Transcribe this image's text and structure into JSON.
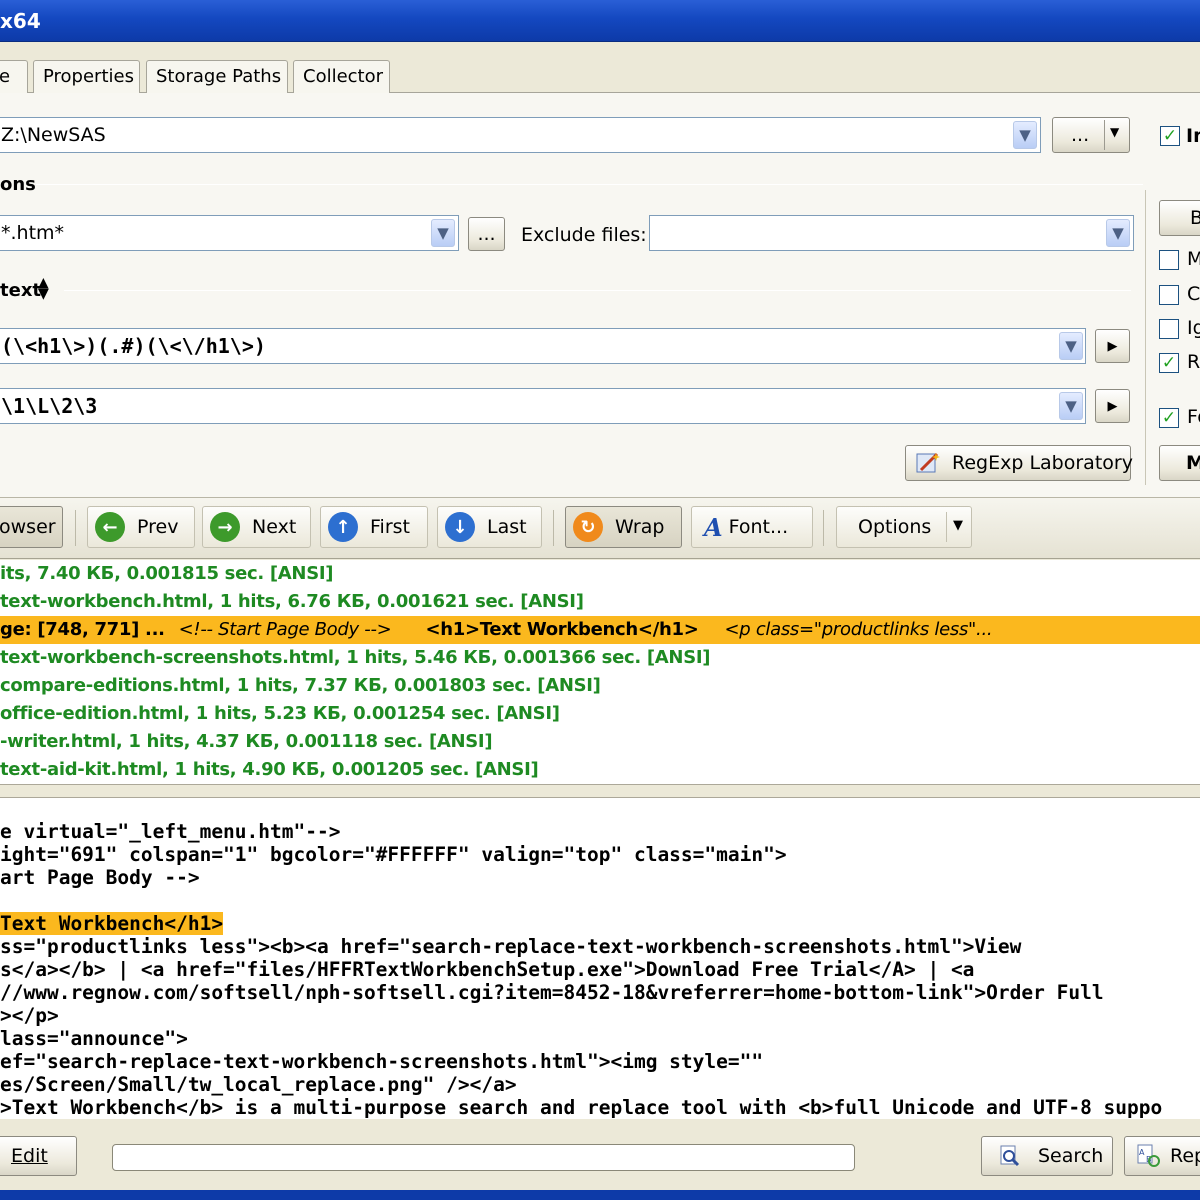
{
  "window": {
    "title": "x64"
  },
  "tabs": [
    {
      "label": "e"
    },
    {
      "label": "Properties"
    },
    {
      "label": "Storage Paths"
    },
    {
      "label": "Collector"
    }
  ],
  "folder": {
    "value": "Z:\\NewSAS",
    "browse_label": "...",
    "include_label": "In"
  },
  "options_section": {
    "label": "ons"
  },
  "file_mask": {
    "value": "*.htm*",
    "browse_label": "...",
    "exclude_label": "Exclude files:",
    "exclude_value": ""
  },
  "text_section": {
    "label": "text"
  },
  "find_pattern": {
    "value": "(\\<h1\\>)(.#)(\\<\\/h1\\>)"
  },
  "replace_pattern": {
    "value": "\\1\\L\\2\\3"
  },
  "regexp_lab": {
    "label": "RegExp Laboratory"
  },
  "right_panel": {
    "button_top": "B",
    "checks": [
      {
        "label": "M",
        "checked": false
      },
      {
        "label": "C",
        "checked": false
      },
      {
        "label": "Ig",
        "checked": false
      },
      {
        "label": "R",
        "checked": true
      },
      {
        "label": "Fo",
        "checked": true
      }
    ],
    "button_bottom": "M"
  },
  "toolbar": {
    "browser": "owser",
    "prev": "Prev",
    "next": "Next",
    "first": "First",
    "last": "Last",
    "wrap": "Wrap",
    "font": "Font...",
    "options": "Options"
  },
  "results": [
    {
      "text": "its, 7.40 КБ, 0.001815 sec. [ANSI]"
    },
    {
      "text": "text-workbench.html, 1 hits, 6.76 КБ, 0.001621 sec. [ANSI]"
    },
    {
      "text_a": "ge: [748, 771] ...",
      "text_b": "<!-- Start Page Body -->",
      "text_c": "<h1>Text Workbench</h1>",
      "text_d": "<p class=\"productlinks less\"..."
    },
    {
      "text": "text-workbench-screenshots.html, 1 hits, 5.46 КБ, 0.001366 sec. [ANSI]"
    },
    {
      "text": "compare-editions.html, 1 hits, 7.37 КБ, 0.001803 sec. [ANSI]"
    },
    {
      "text": "office-edition.html, 1 hits, 5.23 КБ, 0.001254 sec. [ANSI]"
    },
    {
      "text": "-writer.html, 1 hits, 4.37 КБ, 0.001118 sec. [ANSI]"
    },
    {
      "text": "text-aid-kit.html, 1 hits, 4.90 КБ, 0.001205 sec. [ANSI]"
    }
  ],
  "code_lines": [
    "e virtual=\"_left_menu.htm\"-->",
    "ight=\"691\" colspan=\"1\" bgcolor=\"#FFFFFF\" valign=\"top\" class=\"main\">",
    "art Page Body -->",
    "",
    "Text Workbench</h1>",
    "ss=\"productlinks less\"><b><a href=\"search-replace-text-workbench-screenshots.html\">View",
    "s</a></b> | <a href=\"files/HFFRTextWorkbenchSetup.exe\">Download Free Trial</A> | <a",
    "//www.regnow.com/softsell/nph-softsell.cgi?item=8452-18&vreferrer=home-bottom-link\">Order Full",
    "></p>",
    "lass=\"announce\">",
    "ef=\"search-replace-text-workbench-screenshots.html\"><img style=\"\"",
    "es/Screen/Small/tw_local_replace.png\" /></a>",
    ">Text Workbench</b> is a multi-purpose search and replace tool with <b>full Unicode and UTF-8 suppo"
  ],
  "bottom": {
    "edit": "Edit",
    "search": "Search",
    "replace": "Rep"
  },
  "colors": {
    "accent": "#fbb81e",
    "result_text": "#1e8a22",
    "title_bar": "#1448c0"
  }
}
